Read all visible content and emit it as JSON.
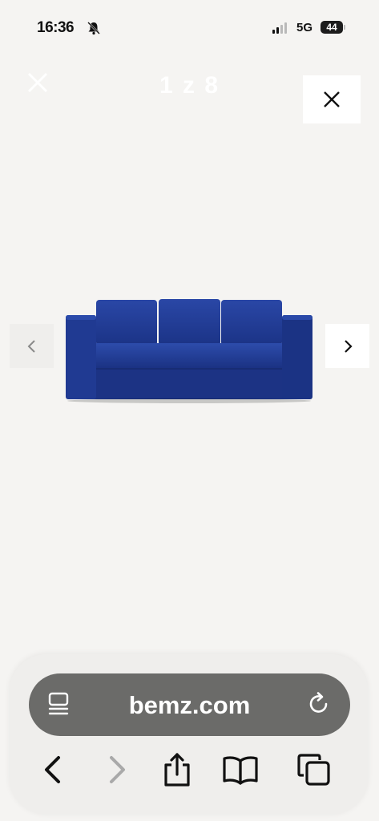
{
  "status_bar": {
    "time": "16:36",
    "network": "5G",
    "battery": "44"
  },
  "gallery": {
    "counter": "1 z 8",
    "image": "blue-three-seat-sofa",
    "accent": "#1f3a94"
  },
  "browser": {
    "url": "bemz.com",
    "icons": [
      "reader-icon",
      "reload-icon",
      "back-icon",
      "forward-icon",
      "share-icon",
      "bookmarks-icon",
      "tabs-icon"
    ]
  }
}
